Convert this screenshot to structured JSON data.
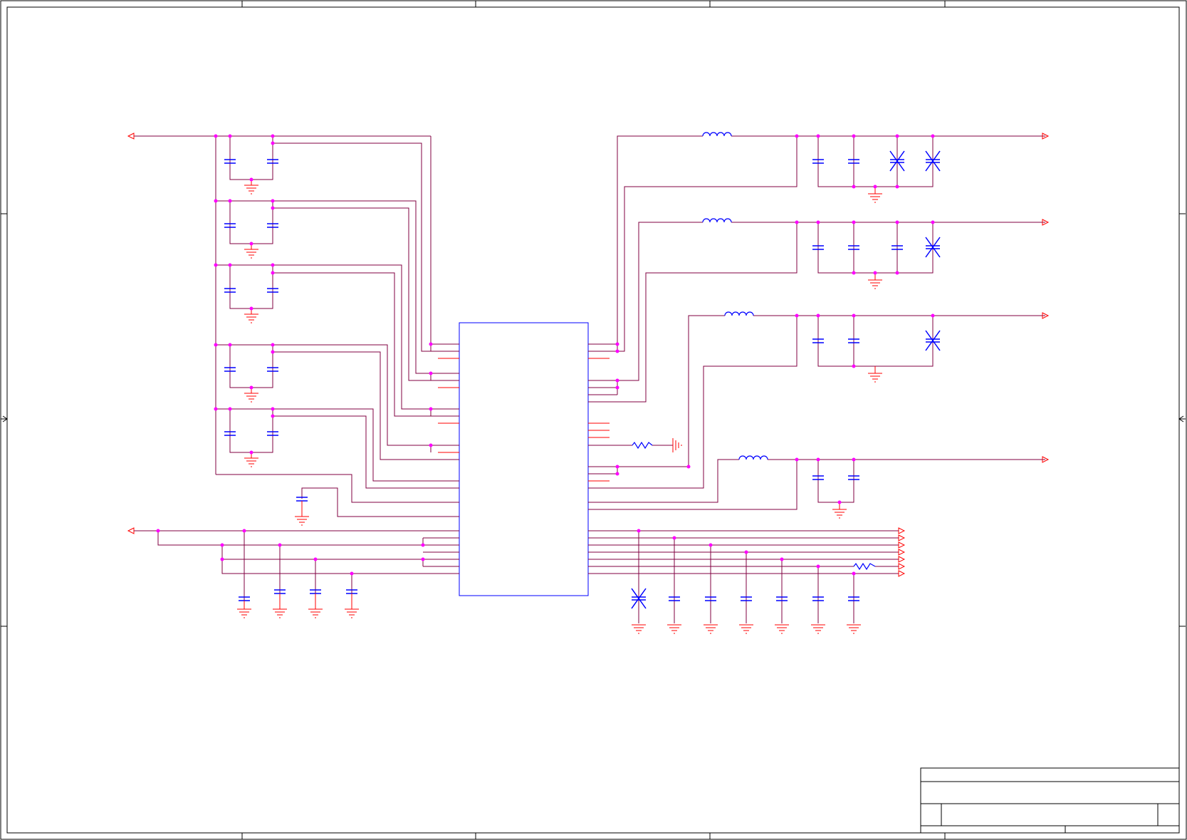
{
  "sheet": {
    "title": ""
  },
  "colors": {
    "border": "#000000",
    "wire": "#800040",
    "pin": "#ff0000",
    "component": "#0000ff",
    "ground": "#ff0000",
    "junction": "#ff00ff",
    "port": "#ff0000"
  }
}
